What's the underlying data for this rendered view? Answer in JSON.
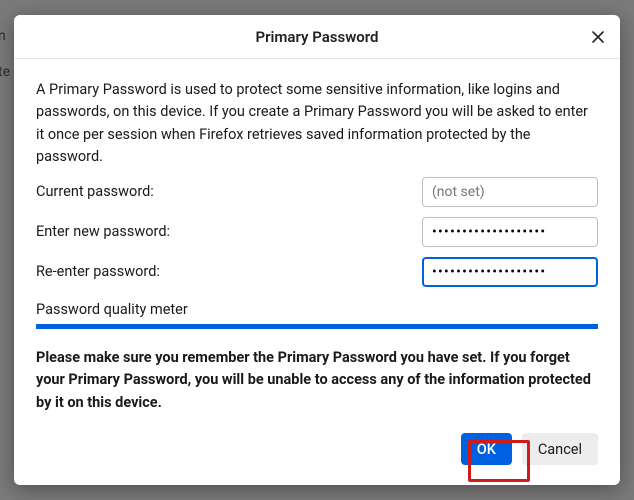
{
  "bg": {
    "line1": "n",
    "line2": "te"
  },
  "dialog": {
    "title": "Primary Password",
    "intro": "A Primary Password is used to protect some sensitive information, like logins and passwords, on this device. If you create a Primary Password you will be asked to enter it once per session when Firefox retrieves saved information protected by the password.",
    "current_label": "Current password:",
    "current_placeholder": "(not set)",
    "new_label": "Enter new password:",
    "new_value": "•••••••••••••••••••",
    "reenter_label": "Re-enter password:",
    "reenter_value": "•••••••••••••••••••",
    "quality_label": "Password quality meter",
    "quality_percent": 100,
    "warning": "Please make sure you remember the Primary Password you have set. If you forget your Primary Password, you will be unable to access any of the information protected by it on this device.",
    "ok_label": "OK",
    "cancel_label": "Cancel"
  },
  "colors": {
    "accent": "#0061e0",
    "highlight": "#d11a1a"
  }
}
